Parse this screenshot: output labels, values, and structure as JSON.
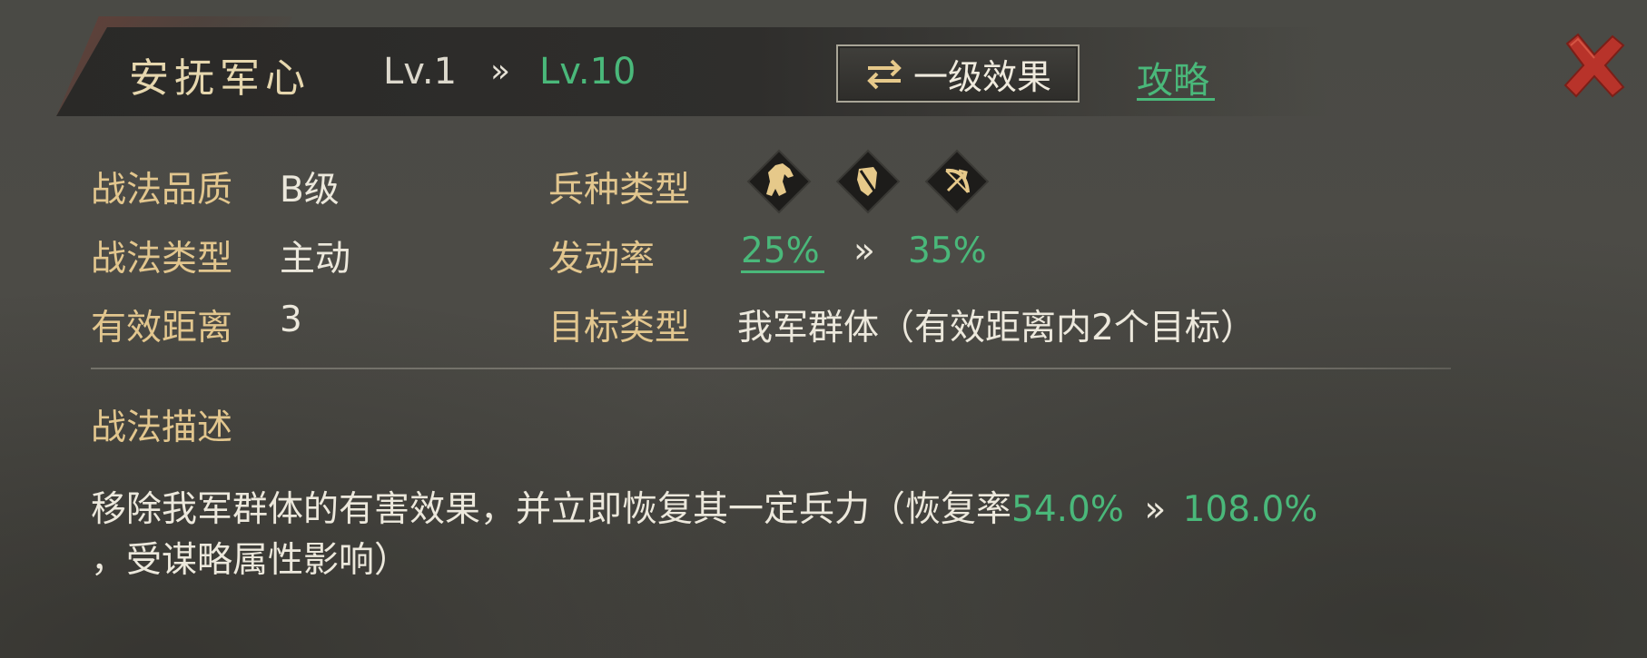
{
  "header": {
    "skill_name": "安抚军心",
    "level_from": "Lv.1",
    "level_arrow": "»",
    "level_to": "Lv.10",
    "effect_button_label": "一级效果",
    "guide_link_label": "攻略"
  },
  "stats": {
    "quality_label": "战法品质",
    "quality_value": "B级",
    "tactic_type_label": "战法类型",
    "tactic_type_value": "主动",
    "range_label": "有效距离",
    "range_value": "3",
    "troop_type_label": "兵种类型",
    "troop_icons": [
      "cavalry-icon",
      "shield-icon",
      "bow-icon"
    ],
    "trigger_rate_label": "发动率",
    "trigger_rate_from": "25%",
    "trigger_rate_arrow": "»",
    "trigger_rate_to": "35%",
    "target_type_label": "目标类型",
    "target_type_value": "我军群体（有效距离内2个目标）"
  },
  "description": {
    "title": "战法描述",
    "line1_text": "移除我军群体的有害效果，并立即恢复其一定兵力（恢复率",
    "line1_value_from": "54.0%",
    "line1_arrow": "»",
    "line1_value_to": "108.0%",
    "line2_text": "，受谋略属性影响）"
  },
  "colors": {
    "accent_green": "#4ab87a",
    "label_gold": "#e2c68e",
    "close_red": "#c0392b"
  }
}
